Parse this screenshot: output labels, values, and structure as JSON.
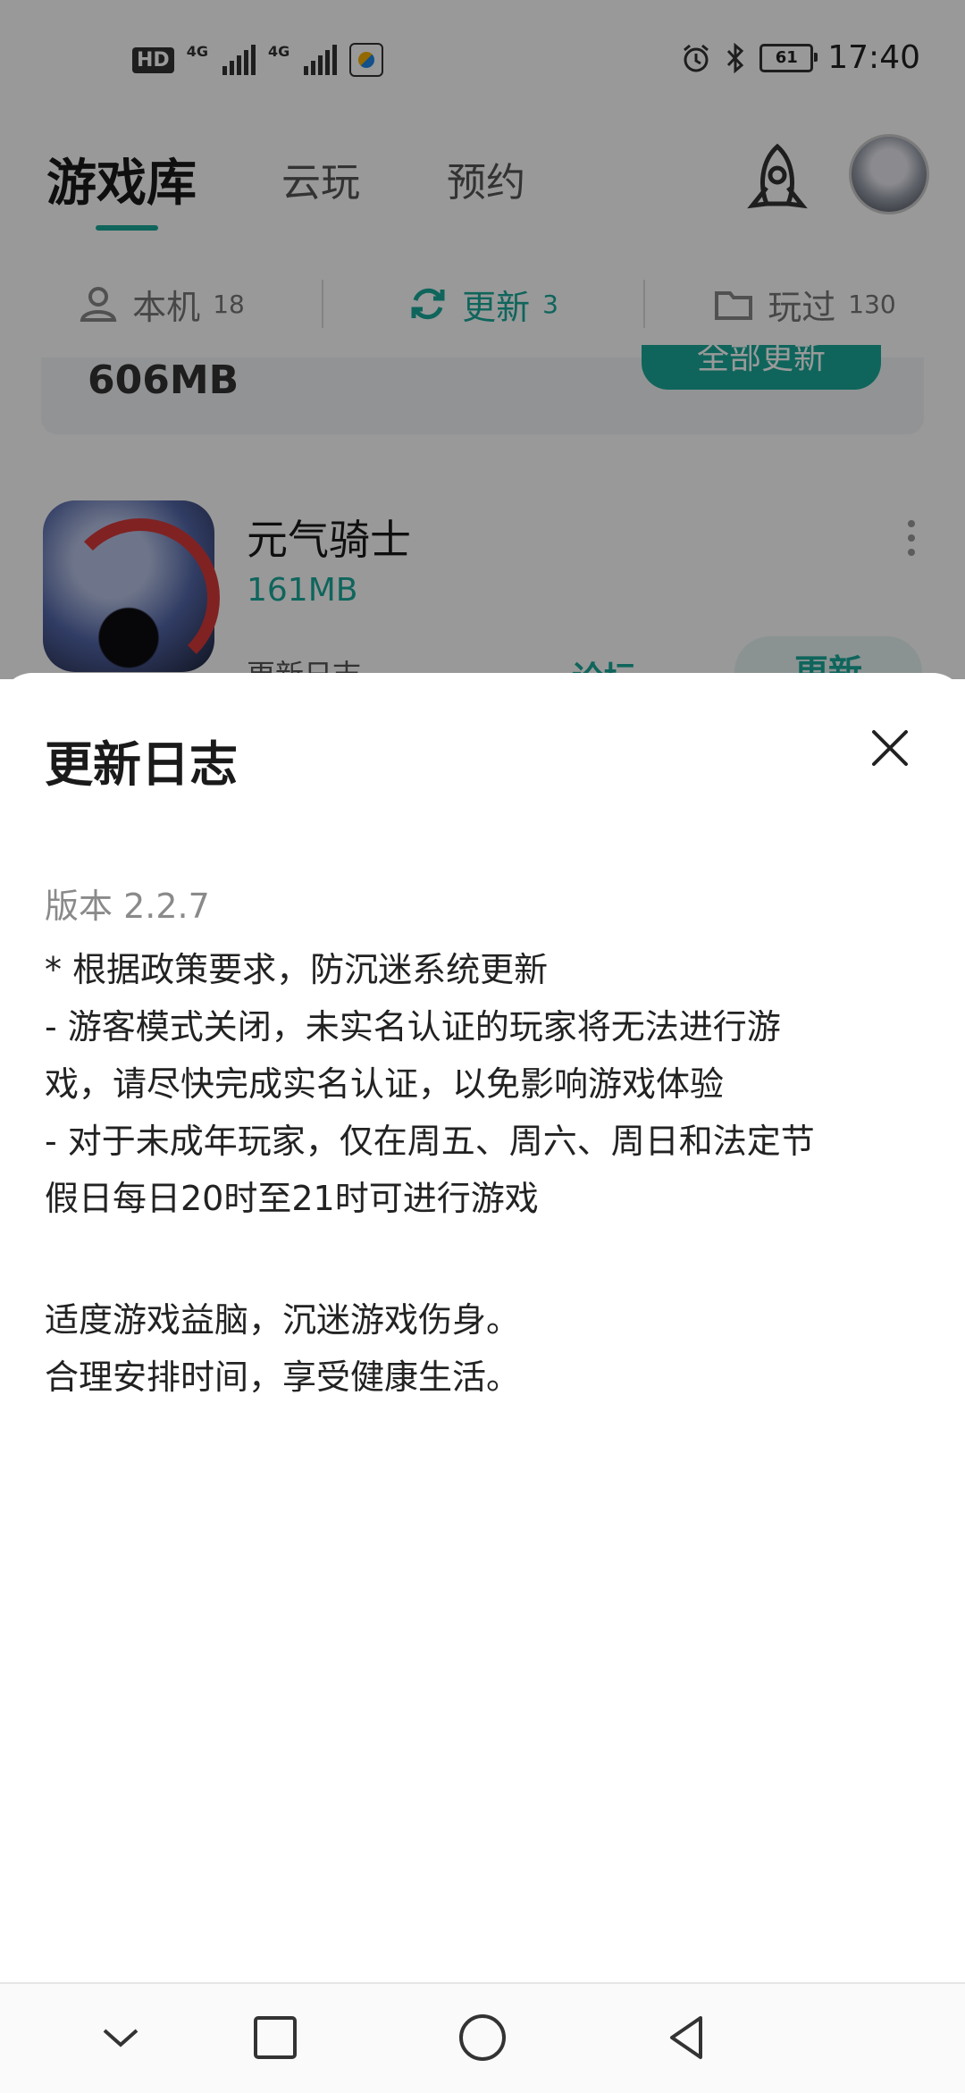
{
  "status_bar": {
    "hd": "HD",
    "sim1": "4G",
    "sim2": "4G",
    "battery": "61",
    "time": "17:40"
  },
  "top_tabs": [
    {
      "label": "游戏库",
      "active": true
    },
    {
      "label": "云玩",
      "active": false
    },
    {
      "label": "预约",
      "active": false
    }
  ],
  "sub_tabs": [
    {
      "label": "本机",
      "count": "18",
      "icon": "device-user-icon",
      "active": false
    },
    {
      "label": "更新",
      "count": "3",
      "icon": "refresh-icon",
      "active": true
    },
    {
      "label": "玩过",
      "count": "130",
      "icon": "folder-icon",
      "active": false
    }
  ],
  "summary": {
    "total_size": "606MB",
    "update_all_label": "全部更新"
  },
  "game": {
    "title": "元气骑士",
    "size": "161MB",
    "changelog_label": "更新日志",
    "forum_label": "论坛",
    "update_label": "更新"
  },
  "sheet": {
    "title": "更新日志",
    "version": "版本 2.2.7",
    "notes": "* 根据政策要求，防沉迷系统更新\n- 游客模式关闭，未实名认证的玩家将无法进行游\n戏，请尽快完成实名认证，以免影响游戏体验\n- 对于未成年玩家，仅在周五、周六、周日和法定节\n假日每日20时至21时可进行游戏",
    "tip1": "适度游戏益脑，沉迷游戏伤身。",
    "tip2": "合理安排时间，享受健康生活。"
  },
  "colors": {
    "accent": "#1aa99a",
    "overlay": "rgba(0,0,0,0.40)"
  }
}
